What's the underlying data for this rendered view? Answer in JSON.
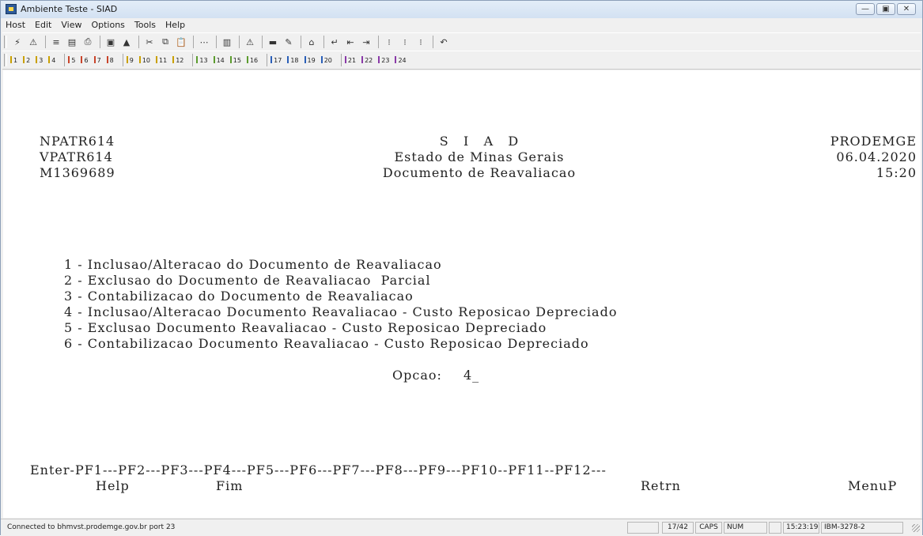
{
  "window": {
    "title": "Ambiente Teste - SIAD"
  },
  "menubar": [
    "Host",
    "Edit",
    "View",
    "Options",
    "Tools",
    "Help"
  ],
  "pf_buttons": [
    "1",
    "2",
    "3",
    "4",
    "5",
    "6",
    "7",
    "8",
    "9",
    "10",
    "11",
    "12",
    "13",
    "14",
    "15",
    "16",
    "17",
    "18",
    "19",
    "20",
    "21",
    "22",
    "23",
    "24"
  ],
  "terminal": {
    "header": {
      "left": [
        "NPATR614",
        "VPATR614",
        "M1369689"
      ],
      "center": [
        "S   I   A   D",
        "Estado de Minas Gerais",
        "Documento de Reavaliacao"
      ],
      "right": [
        "PRODEMGE",
        "06.04.2020",
        "15:20"
      ]
    },
    "menu_options": [
      "1 - Inclusao/Alteracao do Documento de Reavaliacao",
      "2 - Exclusao do Documento de Reavaliacao  Parcial",
      "3 - Contabilizacao do Documento de Reavaliacao",
      "4 - Inclusao/Alteracao Documento Reavaliacao - Custo Reposicao Depreciado",
      "5 - Exclusao Documento Reavaliacao - Custo Reposicao Depreciado",
      "6 - Contabilizacao Documento Reavaliacao - Custo Reposicao Depreciado"
    ],
    "option_label": "Opcao:",
    "option_value": "4_",
    "pf_line": "Enter-PF1---PF2---PF3---PF4---PF5---PF6---PF7---PF8---PF9---PF10--PF11--PF12---",
    "pf_desc": {
      "help": "Help",
      "fim": "Fim",
      "retrn": "Retrn",
      "menup": "MenuP"
    }
  },
  "statusbar": {
    "connection": "Connected to bhmvst.prodemge.gov.br port 23",
    "cursor": "17/42",
    "caps": "CAPS",
    "num": "NUM",
    "time": "15:23:19",
    "terminal_type": "IBM-3278-2"
  }
}
